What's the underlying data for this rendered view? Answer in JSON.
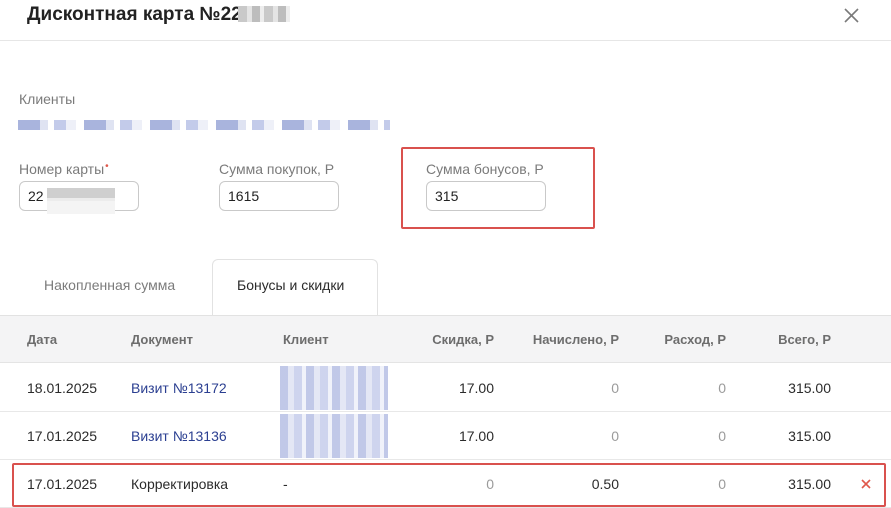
{
  "dialog": {
    "title": "Дисконтная карта №22"
  },
  "form": {
    "clients_label": "Клиенты",
    "card_number_label": "Номер карты",
    "card_number_required_mark": "•",
    "card_number_value": "22",
    "purchases_label": "Сумма покупок, Р",
    "purchases_value": "1615",
    "bonus_label": "Сумма бонусов, Р",
    "bonus_value": "315"
  },
  "tabs": [
    {
      "label": "Накопленная сумма",
      "active": false
    },
    {
      "label": "Бонусы и скидки",
      "active": true
    }
  ],
  "table": {
    "columns": [
      "Дата",
      "Документ",
      "Клиент",
      "Скидка, Р",
      "Начислено, Р",
      "Расход, Р",
      "Всего, Р"
    ],
    "rows": [
      {
        "date": "18.01.2025",
        "document": "Визит №13172",
        "client": "",
        "discount": "17.00",
        "accrued": "0",
        "expense": "0",
        "total": "315.00"
      },
      {
        "date": "17.01.2025",
        "document": "Визит №13136",
        "client": "",
        "discount": "17.00",
        "accrued": "0",
        "expense": "0",
        "total": "315.00"
      },
      {
        "date": "17.01.2025",
        "document": "Корректировка",
        "client": "-",
        "discount": "0",
        "accrued": "0.50",
        "expense": "0",
        "total": "315.00"
      }
    ]
  },
  "icons": {
    "close": "close-icon",
    "delete": "delete-icon"
  },
  "colors": {
    "link": "#2b3f91",
    "highlight": "#d9514e",
    "delete": "#e0584b",
    "required": "#e0584b"
  }
}
